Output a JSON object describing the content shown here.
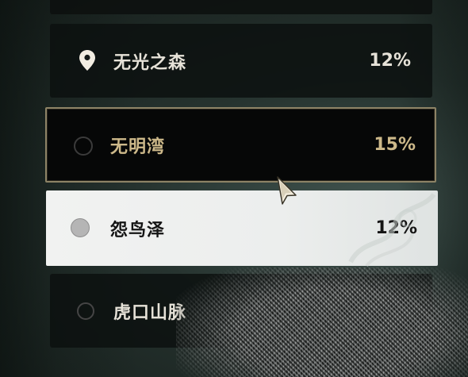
{
  "locations": [
    {
      "name": "无光之森",
      "percent": "12%",
      "state": "current"
    },
    {
      "name": "无明湾",
      "percent": "15%",
      "state": "hovered"
    },
    {
      "name": "怨鸟泽",
      "percent": "12%",
      "state": "selected"
    },
    {
      "name": "虎口山脉",
      "percent": "",
      "state": "default"
    }
  ],
  "colors": {
    "hover_border": "#8d8366",
    "hover_text": "#cdb98a",
    "selected_bg": "#f1f2f1",
    "default_text": "#e6e2d8"
  },
  "icons": {
    "current_location": "map-pin-icon",
    "option_radio": "radio-circle-icon",
    "pointer": "mouse-cursor-icon"
  }
}
